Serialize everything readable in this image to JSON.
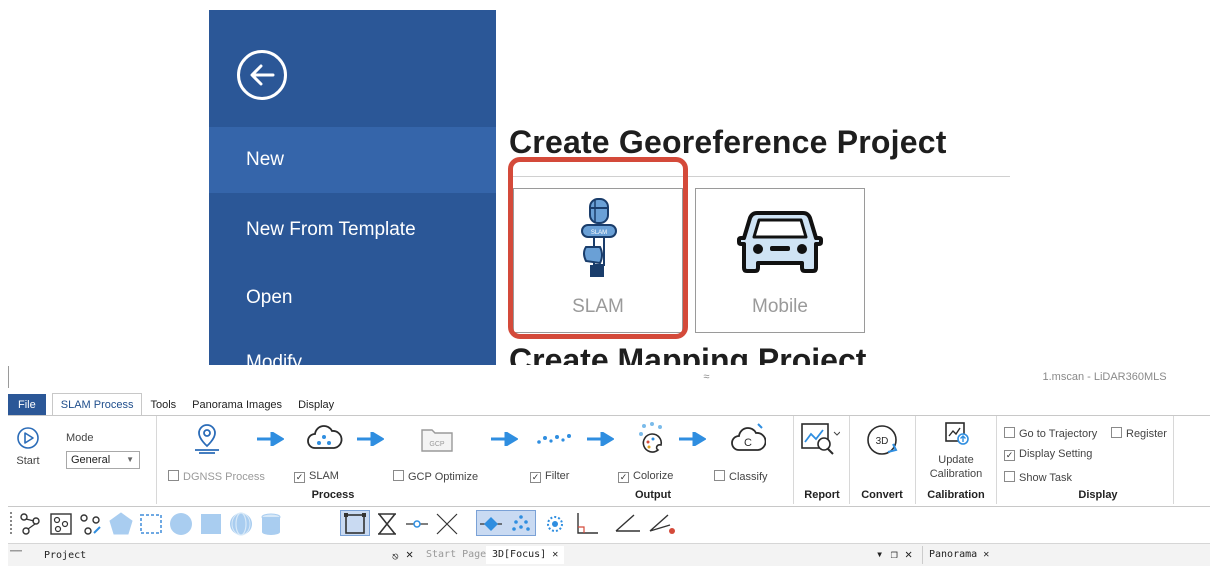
{
  "backstage": {
    "sidebar_items": [
      {
        "label": "New",
        "active": true
      },
      {
        "label": "New From Template",
        "active": false
      },
      {
        "label": "Open",
        "active": false
      },
      {
        "label": "Modify",
        "active": false
      }
    ],
    "heading": "Create Georeference Project",
    "next_heading": "Create Mapping Project",
    "cards": [
      {
        "label": "SLAM",
        "icon": "slam-scanner-icon",
        "highlighted": true
      },
      {
        "label": "Mobile",
        "icon": "car-icon",
        "highlighted": false
      }
    ],
    "colors": {
      "sidebar": "#2b5797",
      "sidebar_active": "#3565aa",
      "highlight": "#d44a3a"
    }
  },
  "window": {
    "title": "1.mscan - LiDAR360MLS",
    "menu_tabs": [
      "File",
      "SLAM Process",
      "Tools",
      "Panorama Images",
      "Display"
    ],
    "active_tab": "SLAM Process",
    "ribbon": {
      "start_label": "Start",
      "mode_label": "Mode",
      "mode_value": "General",
      "process": {
        "group_label": "Process",
        "steps": [
          {
            "label": "DGNSS Process",
            "checked": false,
            "enabled": false
          },
          {
            "label": "SLAM",
            "checked": true,
            "enabled": true
          },
          {
            "label": "GCP Optimize",
            "checked": false,
            "enabled": true
          }
        ]
      },
      "output": {
        "group_label": "Output",
        "steps": [
          {
            "label": "Filter",
            "checked": true
          },
          {
            "label": "Colorize",
            "checked": true
          },
          {
            "label": "Classify",
            "checked": false
          }
        ]
      },
      "report_label": "Report",
      "convert_label": "Convert",
      "calibration": {
        "button_line1": "Update",
        "button_line2": "Calibration",
        "group_label": "Calibration"
      },
      "display": {
        "group_label": "Display",
        "options": [
          {
            "label": "Go to Trajectory",
            "checked": false
          },
          {
            "label": "Register",
            "checked": false
          },
          {
            "label": "Display Setting",
            "checked": true
          },
          {
            "label": "Show Task",
            "checked": false
          }
        ]
      }
    },
    "panes": {
      "project": "Project",
      "tabs": [
        "Start Page",
        "3D[Focus]",
        "Panorama"
      ]
    }
  }
}
